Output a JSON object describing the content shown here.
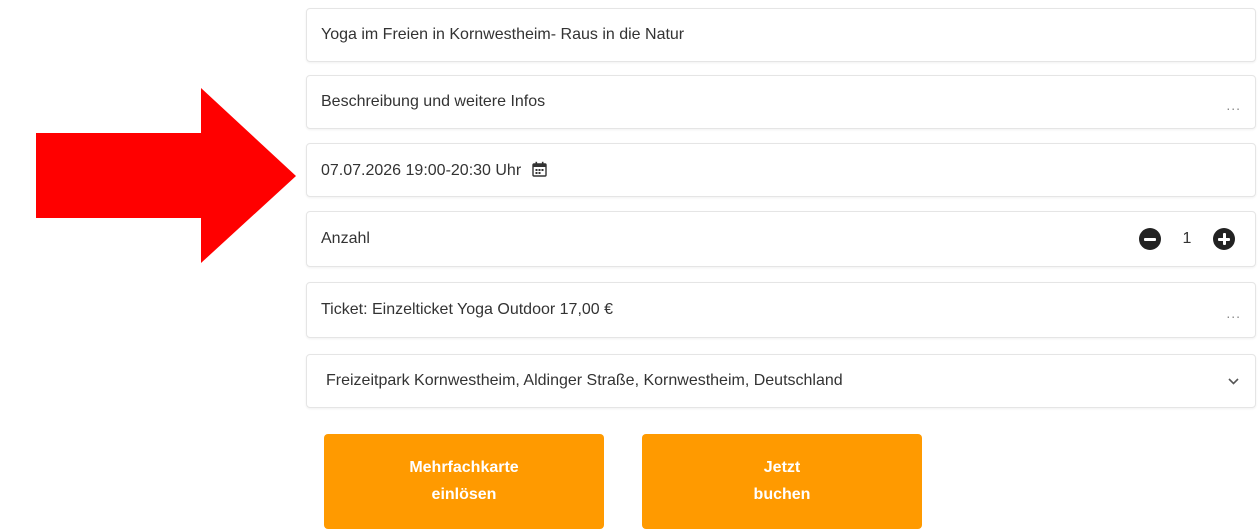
{
  "event": {
    "title": "Yoga im Freien in Kornwestheim- Raus in die Natur",
    "description_label": "Beschreibung und weitere Infos",
    "description_more": "...",
    "date_time": "07.07.2026 19:00-20:30 Uhr",
    "quantity_label": "Anzahl",
    "quantity_value": "1",
    "ticket_label": "Ticket: Einzelticket Yoga Outdoor 17,00 €",
    "ticket_more": "...",
    "location": "Freizeitpark Kornwestheim, Aldinger Straße, Kornwestheim, Deutschland"
  },
  "buttons": {
    "redeem_line1": "Mehrfachkarte",
    "redeem_line2": "einlösen",
    "book_line1": "Jetzt",
    "book_line2": "buchen"
  },
  "icons": {
    "arrow": "red-arrow-icon",
    "calendar": "calendar-icon",
    "minus": "minus-circle-icon",
    "plus": "plus-circle-icon",
    "dropdown": "chevron-down-icon"
  },
  "colors": {
    "arrow": "#ff0000",
    "button": "#ff9a00",
    "button_text": "#ffffff",
    "counter_icon": "#222222"
  }
}
